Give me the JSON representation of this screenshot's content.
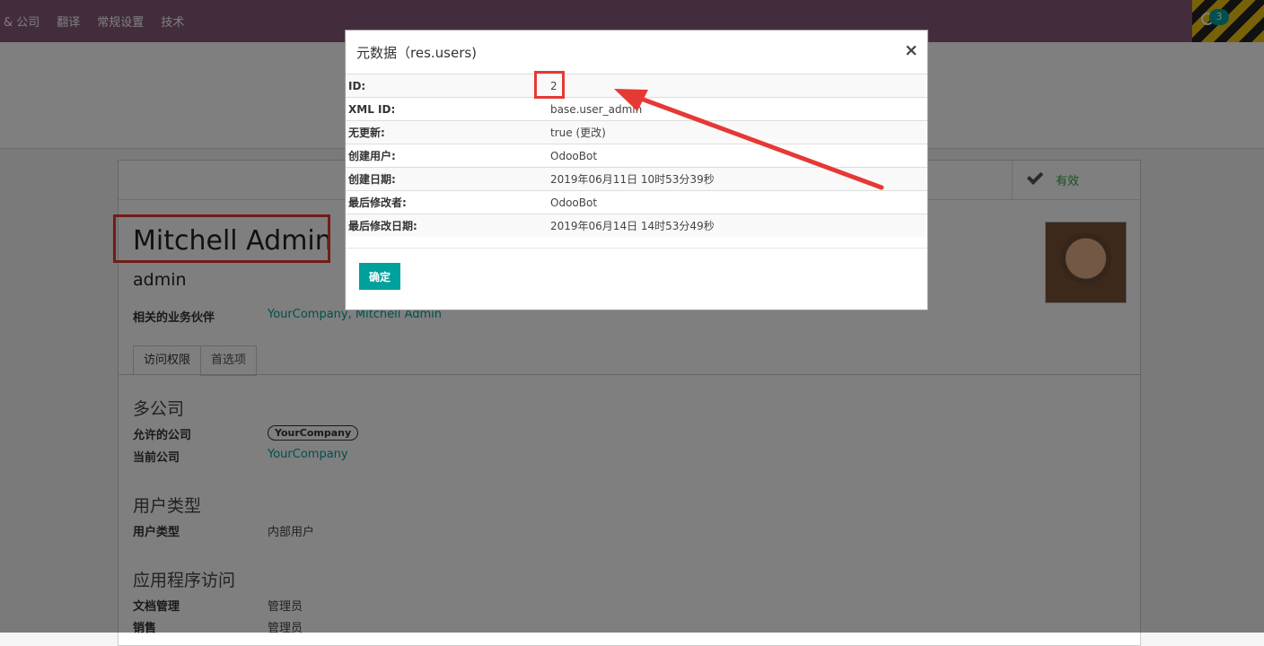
{
  "topbar": {
    "menu": [
      "& 公司",
      "翻译",
      "常规设置",
      "技术"
    ],
    "activity_count": "3"
  },
  "form": {
    "status_label": "有效",
    "name": "Mitchell Admin",
    "login": "admin",
    "partner_label": "相关的业务伙伴",
    "partner_value": "YourCompany, Mitchell Admin",
    "tabs": [
      "访问权限",
      "首选项"
    ],
    "sections": {
      "multi_company": {
        "title": "多公司",
        "allowed_label": "允许的公司",
        "allowed_value": "YourCompany",
        "current_label": "当前公司",
        "current_value": "YourCompany"
      },
      "user_type": {
        "title": "用户类型",
        "label": "用户类型",
        "value": "内部用户"
      },
      "app_access": {
        "title": "应用程序访问",
        "rows": [
          {
            "label": "文档管理",
            "value": "管理员"
          },
          {
            "label": "销售",
            "value": "管理员"
          }
        ]
      }
    }
  },
  "dialog": {
    "title": "元数据（res.users)",
    "close": "×",
    "rows": [
      {
        "key": "ID:",
        "value": "2"
      },
      {
        "key": "XML ID:",
        "value": "base.user_admin"
      },
      {
        "key": "无更新:",
        "value": "true (更改)"
      },
      {
        "key": "创建用户:",
        "value": "OdooBot"
      },
      {
        "key": "创建日期:",
        "value": "2019年06月11日 10时53分39秒"
      },
      {
        "key": "最后修改者:",
        "value": "OdooBot"
      },
      {
        "key": "最后修改日期:",
        "value": "2019年06月14日 14时53分49秒"
      }
    ],
    "ok_label": "确定"
  },
  "colors": {
    "brand": "#875a7b",
    "accent": "#00a09d",
    "highlight": "#e53935"
  }
}
